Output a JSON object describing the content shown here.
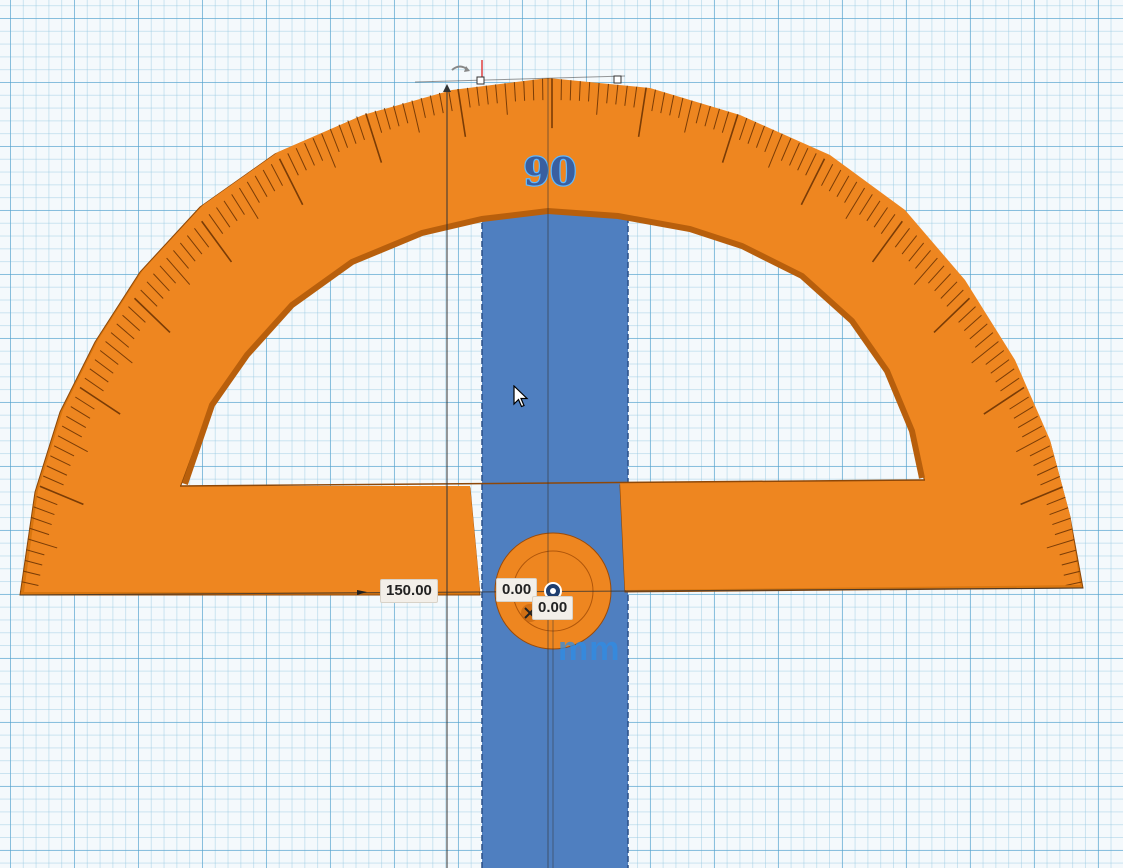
{
  "scene": {
    "protractor_label": "90",
    "ghost_text": "mm",
    "colors": {
      "protractor": "#ee8620",
      "protractor_edge": "#9a4a08",
      "bar": "#4f7fc0",
      "workplane": "#f4f9fc",
      "grid_major": "#50a0cd",
      "text_outline": "#2f8fe0"
    },
    "icons": [
      "rotate-handle-icon",
      "scale-handle-icon",
      "origin-marker-icon",
      "close-x-icon",
      "mouse-cursor-icon"
    ]
  },
  "dimensions": {
    "length": "150.00",
    "offset_x": "0.00",
    "offset_y": "0.00"
  }
}
